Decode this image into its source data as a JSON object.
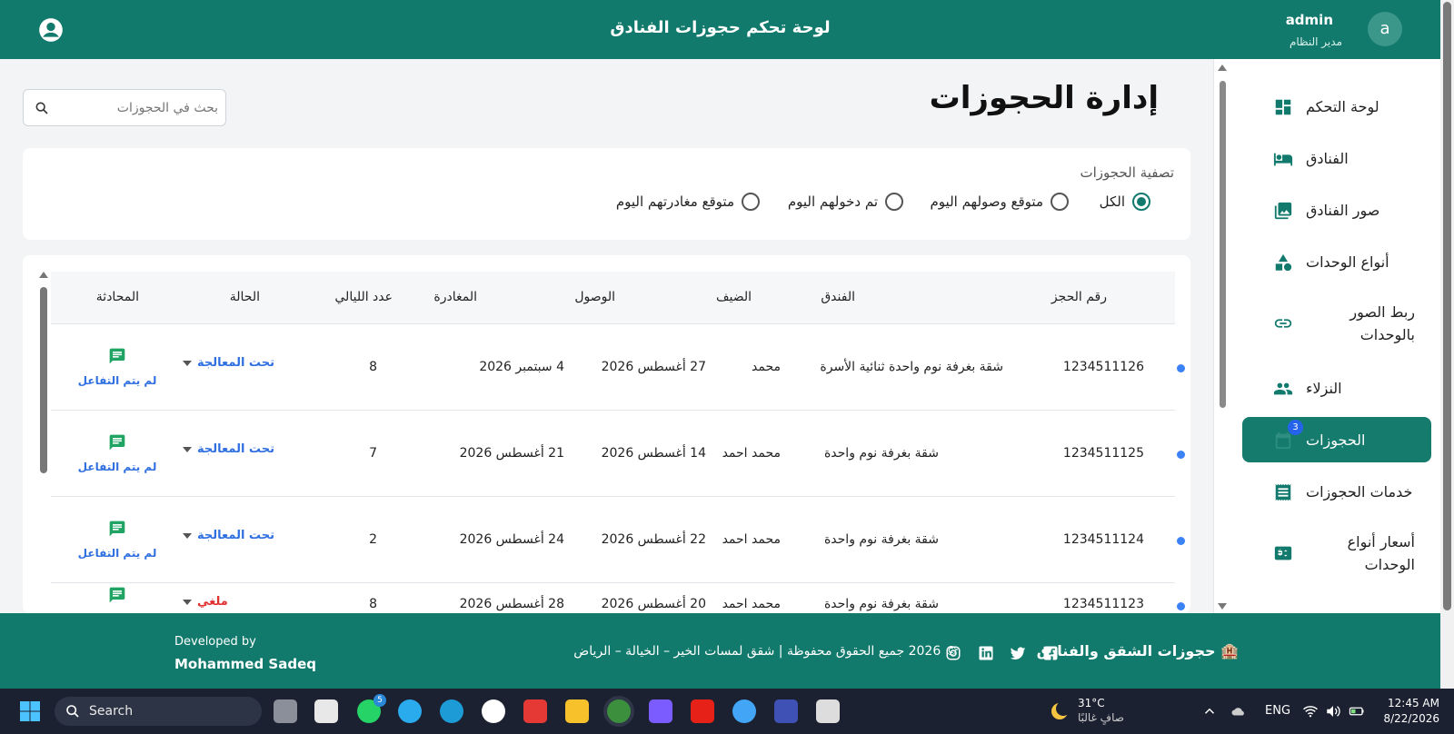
{
  "header": {
    "title": "لوحة تحكم حجوزات الفنادق",
    "user_name": "admin",
    "user_role": "مدير النظام",
    "avatar_letter": "a"
  },
  "sidebar": {
    "items": [
      {
        "label": "لوحة التحكم",
        "icon": "dashboard-icon"
      },
      {
        "label": "الفنادق",
        "icon": "bed-icon"
      },
      {
        "label": "صور الفنادق",
        "icon": "image-icon"
      },
      {
        "label": "أنواع الوحدات",
        "icon": "shapes-icon"
      },
      {
        "label": "ربط الصور بالوحدات",
        "icon": "link-icon"
      },
      {
        "label": "النزلاء",
        "icon": "people-icon"
      },
      {
        "label": "الحجوزات",
        "icon": "calendar-icon",
        "badge": "3",
        "active": true
      },
      {
        "label": "خدمات الحجوزات",
        "icon": "receipt-icon"
      },
      {
        "label": "أسعار أنواع الوحدات",
        "icon": "price-icon"
      }
    ]
  },
  "page": {
    "title": "إدارة الحجوزات",
    "search_placeholder": "بحث في الحجوزات"
  },
  "filter": {
    "label": "تصفية الحجوزات",
    "options": [
      "الكل",
      "متوقع وصولهم اليوم",
      "تم دخولهم اليوم",
      "متوقع مغادرتهم اليوم"
    ],
    "selected": "الكل"
  },
  "table": {
    "headers": [
      "رقم الحجز",
      "الفندق",
      "الضيف",
      "الوصول",
      "المغادرة",
      "عدد الليالي",
      "الحالة",
      "المحادثة"
    ],
    "rows": [
      {
        "id": "1234511126",
        "hotel": "شقة بغرفة نوم واحدة ثنائية الأسرة",
        "guest": "محمد",
        "arrival": "27 أغسطس 2026",
        "departure": "4 سبتمبر 2026",
        "nights": "8",
        "status": "تحت المعالجة",
        "chat": "لم يتم التفاعل"
      },
      {
        "id": "1234511125",
        "hotel": "شقة بغرفة نوم واحدة",
        "guest": "محمد احمد",
        "arrival": "14 أغسطس 2026",
        "departure": "21 أغسطس 2026",
        "nights": "7",
        "status": "تحت المعالجة",
        "chat": "لم يتم التفاعل"
      },
      {
        "id": "1234511124",
        "hotel": "شقة بغرفة نوم واحدة",
        "guest": "محمد احمد",
        "arrival": "22 أغسطس 2026",
        "departure": "24 أغسطس 2026",
        "nights": "2",
        "status": "تحت المعالجة",
        "chat": "لم يتم التفاعل"
      },
      {
        "id": "1234511123",
        "hotel": "شقة بغرفة نوم واحدة",
        "guest": "محمد احمد",
        "arrival": "20 أغسطس 2026",
        "departure": "28 أغسطس 2026",
        "nights": "8",
        "status": "ملغي",
        "chat": ""
      }
    ]
  },
  "footer": {
    "dev_prefix": "Developed by",
    "dev_name": "Mohammed Sadeq",
    "copyright": "© 2026 جميع الحقوق محفوظة | شقق لمسات الخير – الخيالة – الرياض",
    "brand": "🏨 حجوزات الشقق والفنادق"
  },
  "taskbar": {
    "search_label": "Search",
    "whatsapp_badge": "5",
    "weather_temp": "31°C",
    "weather_desc": "صافٍ غالبًا",
    "lang": "ENG",
    "time": "12:45 AM",
    "date": "8/22/2026"
  },
  "colors": {
    "primary": "#117a6c",
    "accent_blue": "#2f6fe0",
    "chat_green": "#1fa463",
    "cancel_red": "#e03131"
  }
}
